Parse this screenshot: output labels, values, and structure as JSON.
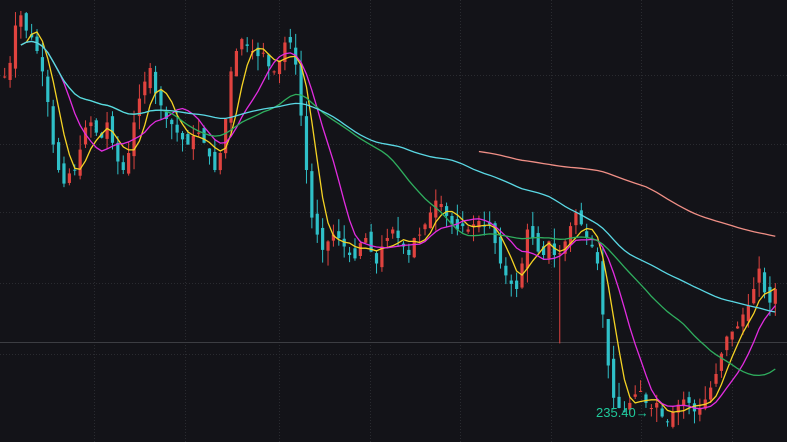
{
  "chart_data": {
    "type": "candlestick",
    "title": "",
    "xlabel": "",
    "ylabel": "",
    "ylim": [
      210,
      470
    ],
    "grid": true,
    "colors": {
      "background": "#131318",
      "grid": "#2a2b30",
      "reference_line": "#3c3d42",
      "up": "#e0433f",
      "down": "#2fc0c8",
      "ma_yellow": "#f5d324",
      "ma_magenta": "#e22ce0",
      "ma_green": "#2fae5e",
      "ma_cyan": "#5ad8e4",
      "ma_pink": "#f08f86",
      "annotation": "#1fc89a"
    },
    "close": [
      425,
      433,
      455,
      461,
      452,
      448,
      440,
      428,
      410,
      385,
      370,
      362,
      368,
      370,
      382,
      395,
      398,
      392,
      389,
      398,
      386,
      375,
      370,
      380,
      398,
      412,
      422,
      430,
      415,
      408,
      400,
      397,
      392,
      388,
      385,
      390,
      392,
      386,
      378,
      370,
      380,
      400,
      428,
      440,
      447,
      443,
      440,
      437,
      439,
      431,
      428,
      434,
      445,
      445,
      432,
      402,
      370,
      342,
      332,
      323,
      328,
      332,
      330,
      325,
      320,
      318,
      327,
      330,
      322,
      315,
      325,
      330,
      335,
      330,
      325,
      320,
      330,
      332,
      338,
      345,
      352,
      350,
      343,
      338,
      335,
      337,
      335,
      338,
      340,
      337,
      338,
      327,
      315,
      308,
      303,
      300,
      315,
      335,
      330,
      322,
      320,
      328,
      320,
      321,
      328,
      337,
      345,
      338,
      330,
      325,
      315,
      285,
      255,
      236,
      230,
      228,
      233,
      238,
      240,
      233,
      230,
      233,
      225,
      222,
      228,
      232,
      235,
      233,
      228,
      230,
      235,
      242,
      250,
      262,
      272,
      275,
      278,
      285,
      290,
      300,
      312,
      298,
      292,
      300
    ],
    "ohlc_sample": {
      "range_high": 462,
      "range_low": 222.5,
      "spike_low": 268
    },
    "moving_averages": [
      {
        "color": "#f5d324",
        "period": 5
      },
      {
        "color": "#e22ce0",
        "period": 10
      },
      {
        "color": "#2fae5e",
        "period": 30
      },
      {
        "color": "#5ad8e4",
        "period": 60
      },
      {
        "color": "#f08f86",
        "period": 120
      }
    ],
    "reference_line_value": 269,
    "annotations": [
      {
        "text": "235.40",
        "arrow": "→",
        "value": 235.4
      }
    ]
  }
}
